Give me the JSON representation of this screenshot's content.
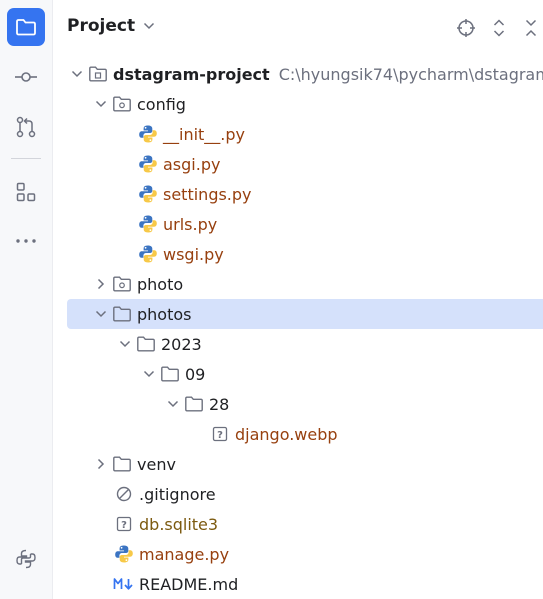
{
  "panel": {
    "title": "Project"
  },
  "tree": {
    "root": {
      "name": "dstagram-project",
      "path": "C:\\hyungsik74\\pycharm\\dstagram-"
    },
    "config": {
      "name": "config",
      "files": [
        "__init__.py",
        "asgi.py",
        "settings.py",
        "urls.py",
        "wsgi.py"
      ]
    },
    "photo": {
      "name": "photo"
    },
    "photos": {
      "name": "photos",
      "year": "2023",
      "month": "09",
      "day": "28",
      "file": "django.webp"
    },
    "venv": {
      "name": "venv"
    },
    "gitignore": ".gitignore",
    "db": "db.sqlite3",
    "manage": "manage.py",
    "readme": "README.md"
  },
  "colors": {
    "accent": "#3574f0",
    "selection": "#d5e1fb",
    "python_file_text": "#97400f",
    "path_text": "#6c707e"
  }
}
